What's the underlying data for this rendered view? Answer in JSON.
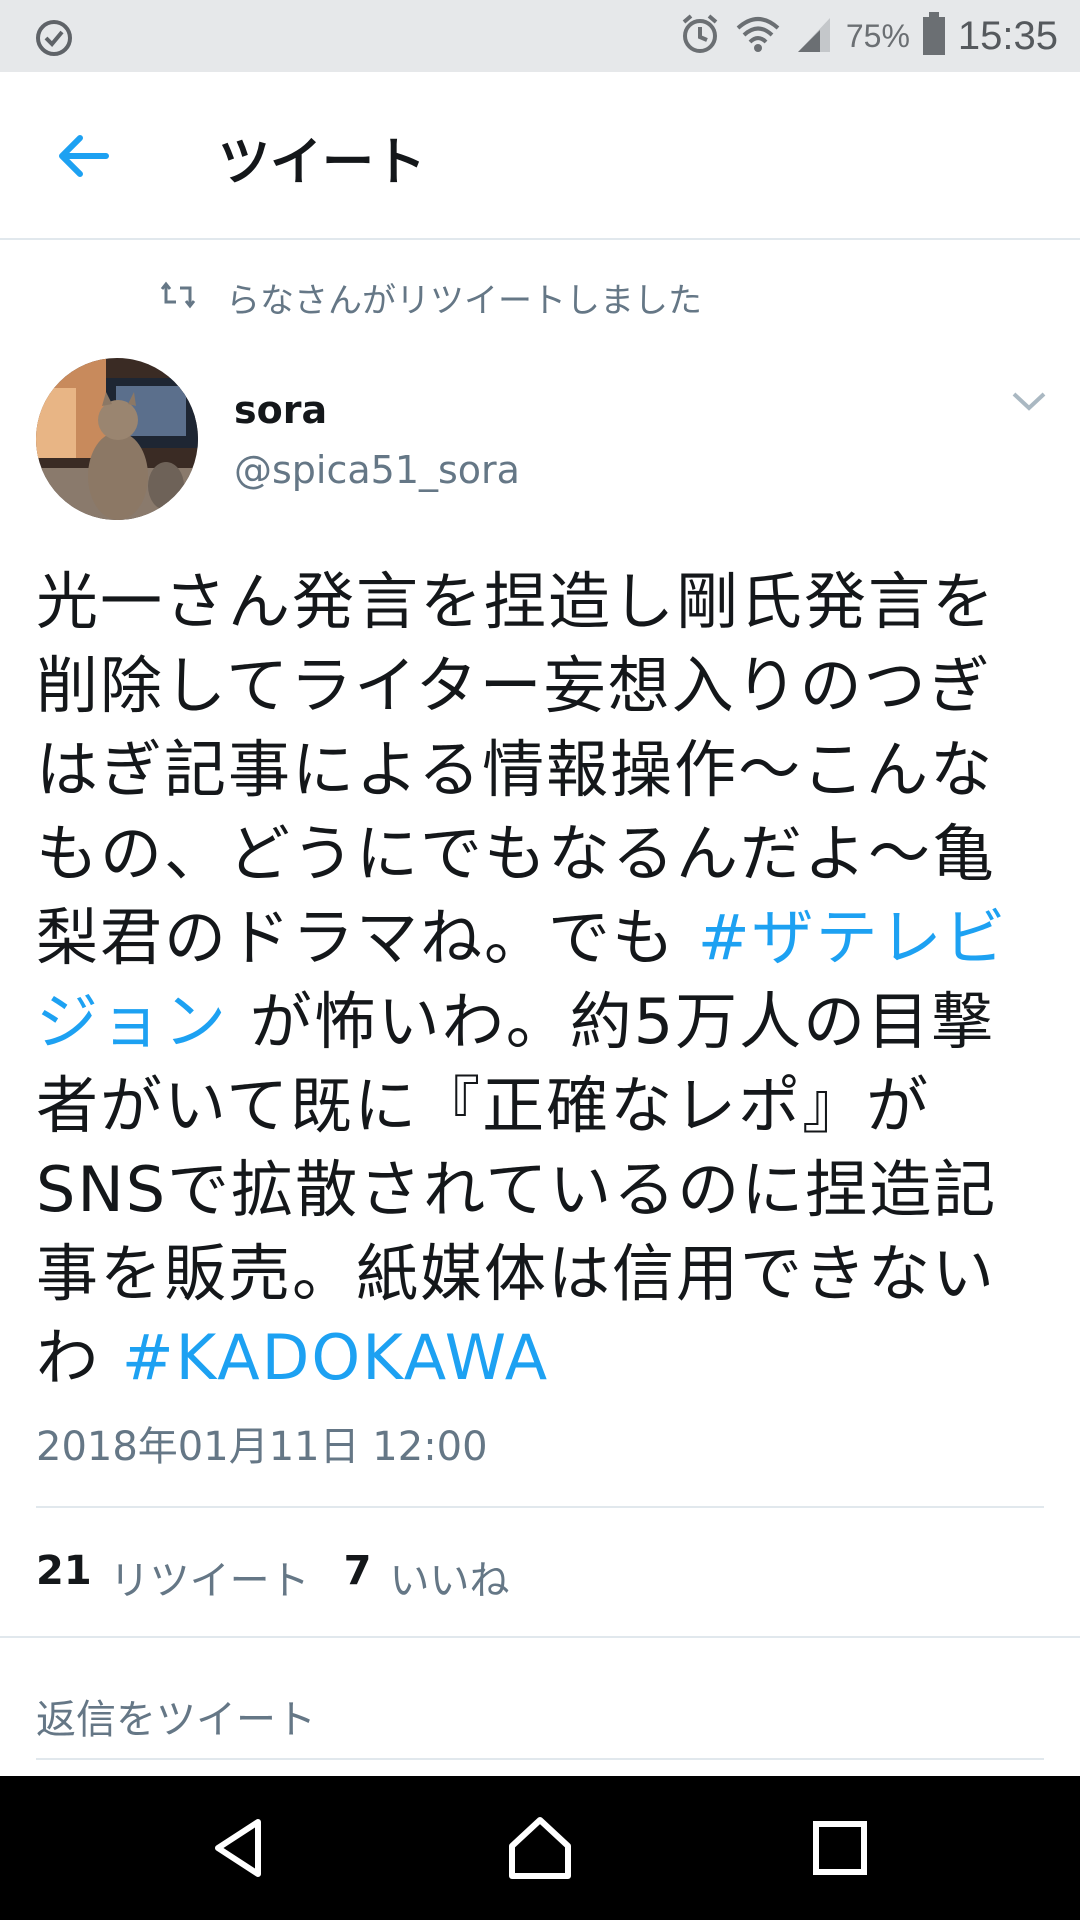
{
  "status_bar": {
    "battery_pct": "75%",
    "time": "15:35",
    "icons": [
      "check-circle-icon",
      "alarm-icon",
      "wifi-icon",
      "signal-icon",
      "battery-icon"
    ]
  },
  "header": {
    "title": "ツイート",
    "back_icon": "back-arrow-icon"
  },
  "retweet_line": {
    "text": "らなさんがリツイートしました",
    "icon": "retweet-icon"
  },
  "author": {
    "name": "sora",
    "handle": "@spica51_sora"
  },
  "tweet": {
    "text_part1": "光一さん発言を捏造し剛氏発言を削除してライター妄想入りのつぎはぎ記事による情報操作〜こんなもの、どうにでもなるんだよ〜亀梨君のドラマね。でも ",
    "hashtag1": "#ザテレビジョン",
    "text_part2": " が怖いわ。約5万人の目撃者がいて既に『正確なレポ』がSNSで拡散されているのに捏造記事を販売。紙媒体は信用できないわ ",
    "hashtag2": "#KADOKAWA",
    "timestamp": "2018年01月11日 12:00"
  },
  "stats": {
    "retweet_count": "21",
    "retweet_label": "リツイート",
    "like_count": "7",
    "like_label": "いいね"
  },
  "reply": {
    "placeholder": "返信をツイート"
  },
  "colors": {
    "accent": "#1da1f2",
    "secondary_text": "#657786",
    "primary_text": "#14171a",
    "status_bar_bg": "#e6e8ea"
  }
}
